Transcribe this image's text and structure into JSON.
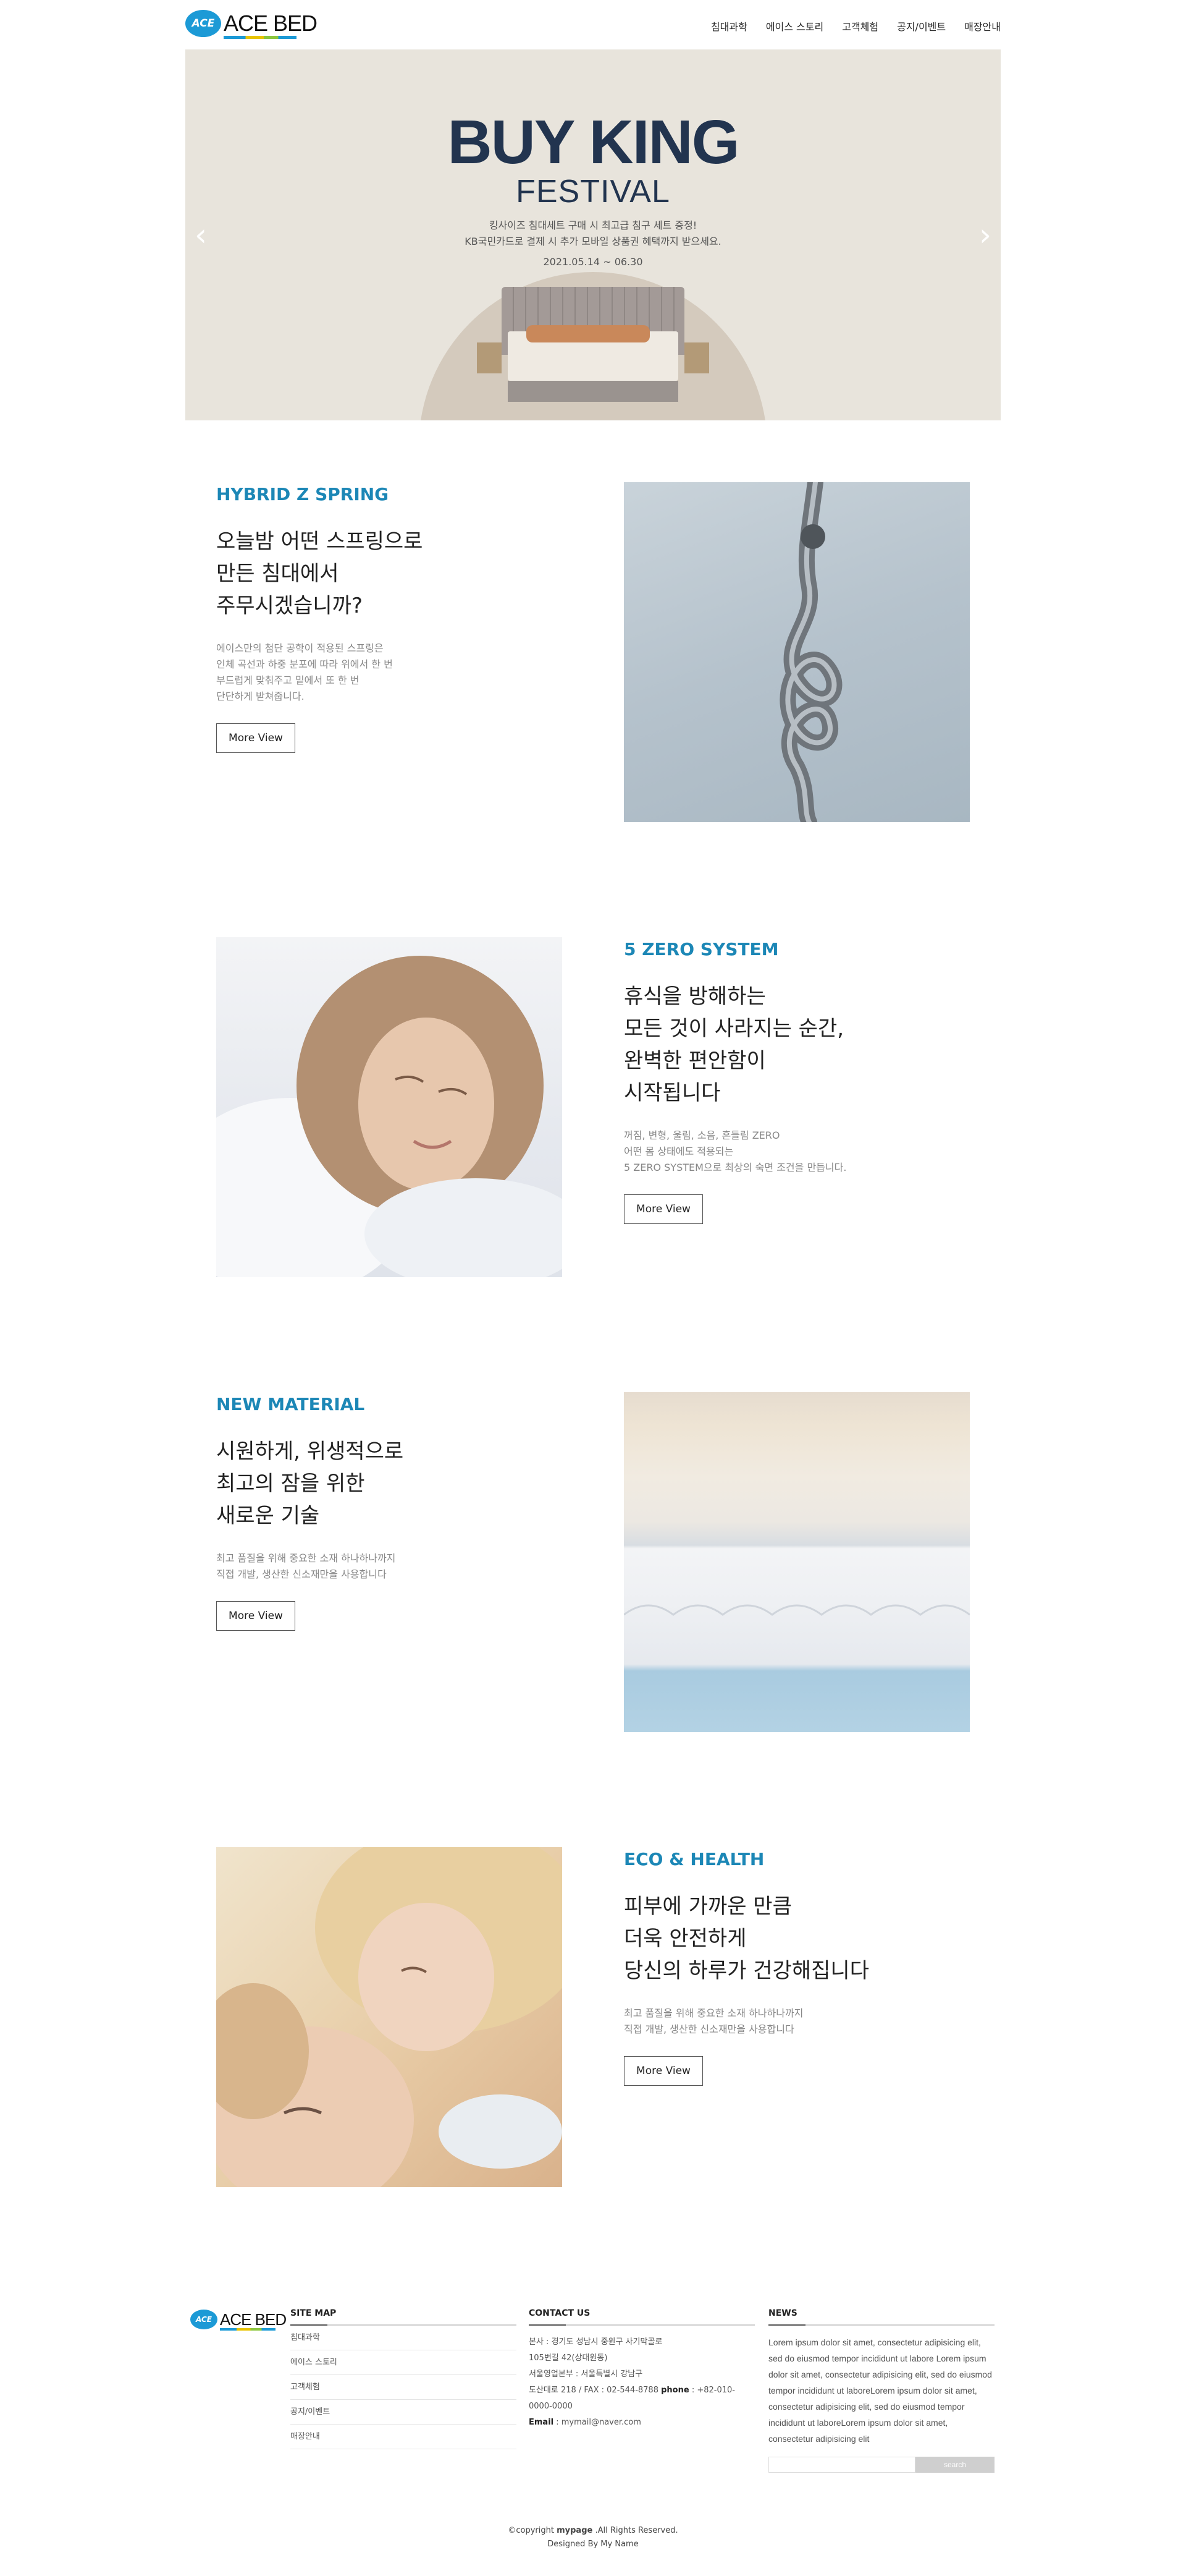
{
  "brand": {
    "badge": "ACE",
    "name": "ACE BED"
  },
  "nav": [
    "침대과학",
    "에이스 스토리",
    "고객체험",
    "공지/이벤트",
    "매장안내"
  ],
  "hero": {
    "title": "BUY KING",
    "subtitle": "FESTIVAL",
    "desc_line1": "킹사이즈 침대세트 구매 시 최고급 침구 세트 증정!",
    "desc_line2": "KB국민카드로 결제 시 추가 모바일 상품권 혜택까지 받으세요.",
    "date": "2021.05.14 ~ 06.30",
    "prev_icon": "‹",
    "next_icon": "›"
  },
  "sections": [
    {
      "kicker": "HYBRID Z SPRING",
      "heading": [
        "오늘밤 어떤 스프링으로",
        "만든 침대에서",
        "주무시겠습니까?"
      ],
      "body": [
        "에이스만의 첨단 공학이 적용된 스프링은",
        "인체 곡선과 하중 분포에 따라 위에서 한 번",
        "부드럽게 맞춰주고 밑에서 또 한 번",
        "단단하게 받쳐줍니다."
      ],
      "button": "More View"
    },
    {
      "kicker": "5 ZERO SYSTEM",
      "heading": [
        "휴식을 방해하는",
        "모든 것이 사라지는 순간,",
        "완벽한 편안함이",
        "시작됩니다"
      ],
      "body": [
        "꺼짐, 변형, 울림, 소음, 흔들림 ZERO",
        "어떤 몸 상태에도 적용되는",
        "5 ZERO SYSTEM으로 최상의 숙면 조건을 만듭니다."
      ],
      "button": "More View"
    },
    {
      "kicker": "NEW MATERIAL",
      "heading": [
        "시원하게, 위생적으로",
        "최고의 잠을 위한",
        "새로운 기술"
      ],
      "body": [
        "최고 품질을 위해 중요한 소재 하나하나까지",
        "직접 개발, 생산한 신소재만을 사용합니다"
      ],
      "button": "More View"
    },
    {
      "kicker": "ECO & HEALTH",
      "heading": [
        "피부에 가까운 만큼",
        "더욱 안전하게",
        "당신의 하루가 건강해집니다"
      ],
      "body": [
        "최고 품질을 위해 중요한 소재 하나하나까지",
        "직접 개발, 생산한 신소재만을 사용합니다"
      ],
      "button": "More View"
    }
  ],
  "footer": {
    "sitemap_title": "SITE MAP",
    "sitemap": [
      "침대과학",
      "에이스 스토리",
      "고객체험",
      "공지/이벤트",
      "매장안내"
    ],
    "contact_title": "CONTACT US",
    "contact": {
      "addr1": "본사 : 경기도 성남시 중원구 사기막골로",
      "addr2": "105번길 42(상대원동)",
      "office": "서울영업본부 : 서울특별시 강남구",
      "phone_prefix": "도산대로 218 / FAX : 02-544-8788",
      "phone_label": "phone",
      "phone_value": " : +82-010-0000-0000",
      "email_label": "Email",
      "email_value": " : mymail@naver.com"
    },
    "news_title": "NEWS",
    "news_text": "Lorem ipsum dolor sit amet, consectetur adipisicing elit, sed do eiusmod tempor incididunt ut labore Lorem ipsum dolor sit amet, consectetur adipisicing elit, sed do eiusmod tempor incididunt ut laboreLorem ipsum dolor sit amet, consectetur adipisicing elit, sed do eiusmod tempor incididunt ut laboreLorem ipsum dolor sit amet, consectetur adipisicing elit",
    "search_placeholder": "",
    "search_button": "search",
    "copyright_prefix": "©copyright ",
    "copyright_brand": "mypage",
    "copyright_suffix": " .All Rights Reserved.",
    "designed": "Designed By My Name"
  },
  "colors": {
    "accent": "#1c87b6",
    "hero_bg": "#e8e4dc",
    "hero_title": "#22344f"
  }
}
